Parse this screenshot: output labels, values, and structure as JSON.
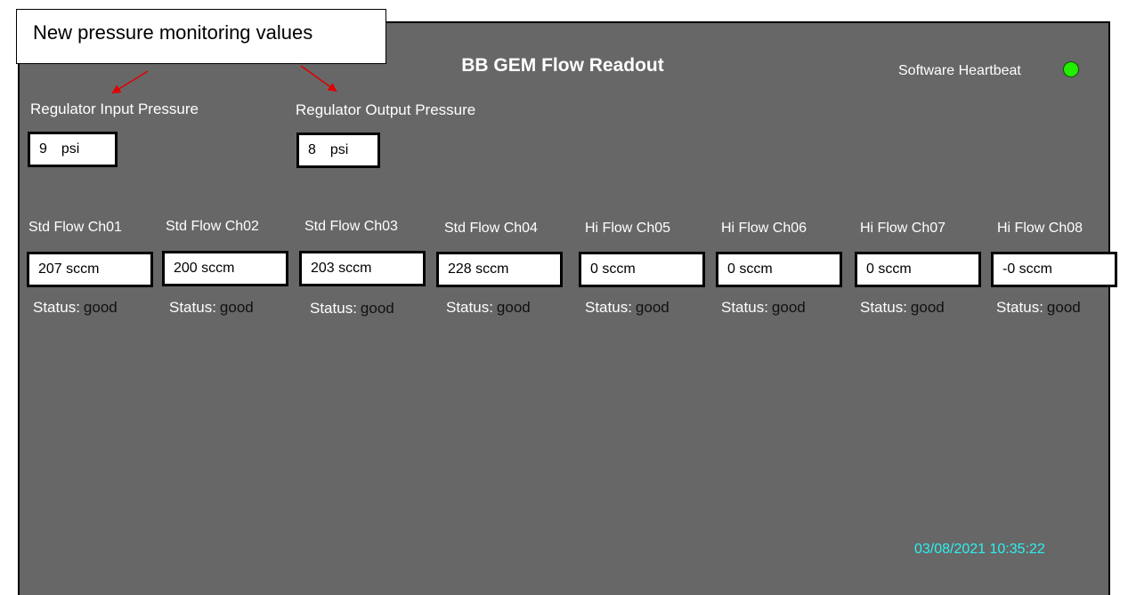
{
  "header": {
    "title": "BB GEM Flow Readout",
    "heartbeat_label": "Software Heartbeat",
    "heartbeat_status": "on",
    "heartbeat_color": "#22ee00"
  },
  "annotation": {
    "callout_text": "New pressure monitoring values",
    "arrow_color": "#e00000"
  },
  "pressures": {
    "input": {
      "label": "Regulator Input Pressure",
      "value": "9",
      "unit": "psi"
    },
    "output": {
      "label": "Regulator Output Pressure",
      "value": "8",
      "unit": "psi"
    }
  },
  "channels": [
    {
      "label": "Std Flow Ch01",
      "value": "207 sccm",
      "status_label": "Status:",
      "status": "good"
    },
    {
      "label": "Std Flow Ch02",
      "value": "200 sccm",
      "status_label": "Status:",
      "status": "good"
    },
    {
      "label": "Std Flow Ch03",
      "value": "203 sccm",
      "status_label": "Status:",
      "status": "good"
    },
    {
      "label": "Std Flow Ch04",
      "value": "228 sccm",
      "status_label": "Status:",
      "status": "good"
    },
    {
      "label": "Hi Flow Ch05",
      "value": "0 sccm",
      "status_label": "Status:",
      "status": "good"
    },
    {
      "label": "Hi Flow Ch06",
      "value": "0 sccm",
      "status_label": "Status:",
      "status": "good"
    },
    {
      "label": "Hi Flow Ch07",
      "value": "0 sccm",
      "status_label": "Status:",
      "status": "good"
    },
    {
      "label": "Hi Flow Ch08",
      "value": "-0 sccm",
      "status_label": "Status:",
      "status": "good"
    }
  ],
  "footer": {
    "timestamp": "03/08/2021 10:35:22",
    "timestamp_color": "#2ef0f0"
  },
  "colors": {
    "panel_background": "#676767",
    "text": "#ffffff"
  }
}
